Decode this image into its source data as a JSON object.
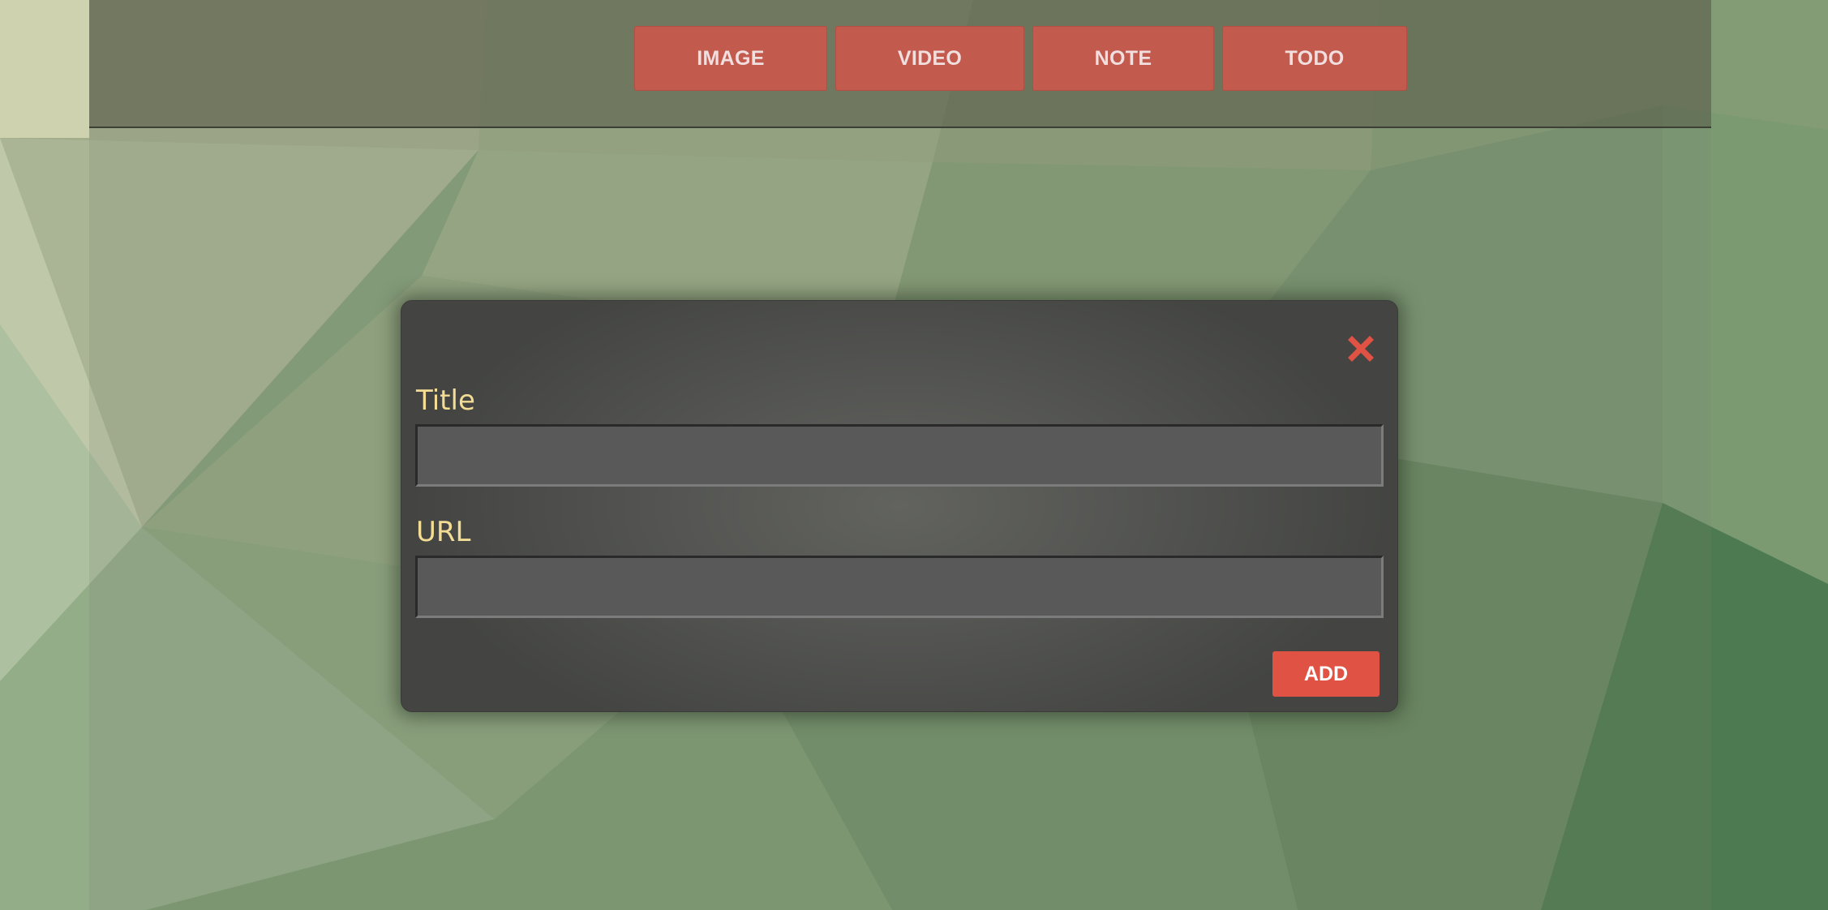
{
  "nav": {
    "buttons": [
      {
        "label": "IMAGE"
      },
      {
        "label": "VIDEO"
      },
      {
        "label": "NOTE"
      },
      {
        "label": "TODO"
      }
    ]
  },
  "modal": {
    "close_icon": "close-x-icon",
    "fields": [
      {
        "label": "Title",
        "value": "",
        "placeholder": ""
      },
      {
        "label": "URL",
        "value": "",
        "placeholder": ""
      }
    ],
    "submit_label": "ADD"
  },
  "colors": {
    "accent": "#e05243",
    "nav_button": "#c25a4e",
    "label_text": "#f3dc93",
    "modal_bg": "#555653"
  }
}
